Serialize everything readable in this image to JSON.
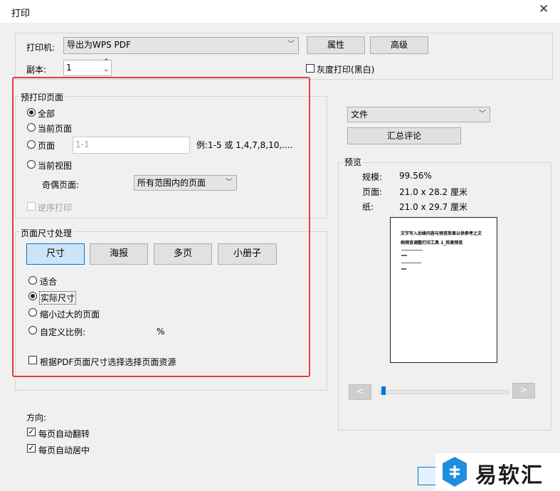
{
  "window": {
    "title": "打印",
    "close": "✕"
  },
  "printer": {
    "label": "打印机:",
    "selected": "导出为WPS PDF",
    "properties_label": "属性",
    "advanced_label": "高级"
  },
  "copies": {
    "label": "副本:",
    "value": "1"
  },
  "grayscale": {
    "label": "灰度打印(黑白)",
    "checked": false
  },
  "print_range": {
    "group_label": "预打印页面",
    "all_label": "全部",
    "current_page_label": "当前页面",
    "pages_label": "页面",
    "pages_value": "1-1",
    "pages_example": "例:1-5 或 1,4,7,8,10,....",
    "current_view_label": "当前视图",
    "odd_even_label": "奇偶页面:",
    "odd_even_selected": "所有范围内的页面",
    "reverse_label": "逆序打印"
  },
  "page_handling": {
    "group_label": "页面尺寸处理",
    "tabs": [
      "尺寸",
      "海报",
      "多页",
      "小册子"
    ],
    "selected_tab": "尺寸",
    "fit_label": "适合",
    "actual_size_label": "实际尺寸",
    "shrink_label": "缩小过大的页面",
    "custom_scale_label": "自定义比例:",
    "percent": "%",
    "choose_source_label": "根据PDF页面尺寸选择选择页面资源"
  },
  "orientation": {
    "label": "方向:",
    "auto_rotate_label": "每页自动翻转",
    "auto_center_label": "每页自动居中"
  },
  "comments": {
    "selected": "文件",
    "summarize_label": "汇总评论"
  },
  "preview": {
    "label": "预览",
    "scale_label": "规模:",
    "scale_value": "99.56%",
    "page_label": "页面:",
    "page_value": "21.0 x 28.2 厘米",
    "paper_label": "纸:",
    "paper_value": "21.0 x 29.7 厘米",
    "doc_title_line1": "文字写入后续内容与预览效果以供参考之文",
    "doc_title_line2": "档预览调整打印工具 1_效果预览",
    "page_progress": 0.02
  },
  "nav": {
    "prev": "<",
    "next": ">"
  },
  "watermark": {
    "text": "易软汇"
  }
}
